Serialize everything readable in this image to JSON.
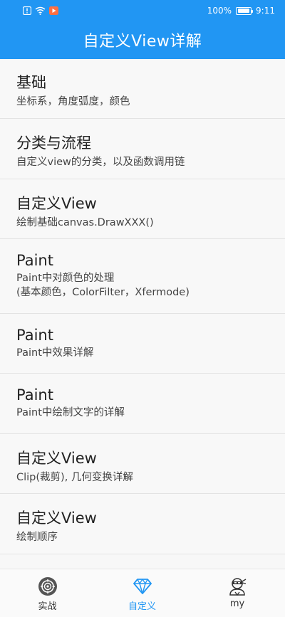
{
  "status_bar": {
    "battery_text": "100%",
    "time": "9:11"
  },
  "header": {
    "title": "自定义View详解",
    "color": "#2196f3"
  },
  "list": {
    "items": [
      {
        "title": "基础",
        "desc": [
          "坐标系，角度弧度，颜色"
        ]
      },
      {
        "title": "分类与流程",
        "desc": [
          "自定义view的分类，以及函数调用链"
        ]
      },
      {
        "title": "自定义View",
        "desc": [
          "绘制基础canvas.DrawXXX()"
        ]
      },
      {
        "title": "Paint",
        "desc": [
          "Paint中对颜色的处理",
          "(基本颜色，ColorFilter，Xfermode)"
        ]
      },
      {
        "title": "Paint",
        "desc": [
          "Paint中效果详解"
        ]
      },
      {
        "title": "Paint",
        "desc": [
          "Paint中绘制文字的详解"
        ]
      },
      {
        "title": "自定义View",
        "desc": [
          "Clip(裁剪), 几何变换详解"
        ]
      },
      {
        "title": "自定义View",
        "desc": [
          "绘制顺序"
        ]
      }
    ]
  },
  "bottom_nav": {
    "tabs": [
      {
        "label": "实战",
        "icon": "target-icon"
      },
      {
        "label": "自定义",
        "icon": "diamond-icon",
        "active": true
      },
      {
        "label": "my",
        "icon": "ninja-avatar-icon"
      }
    ],
    "active_color": "#2196f3"
  }
}
